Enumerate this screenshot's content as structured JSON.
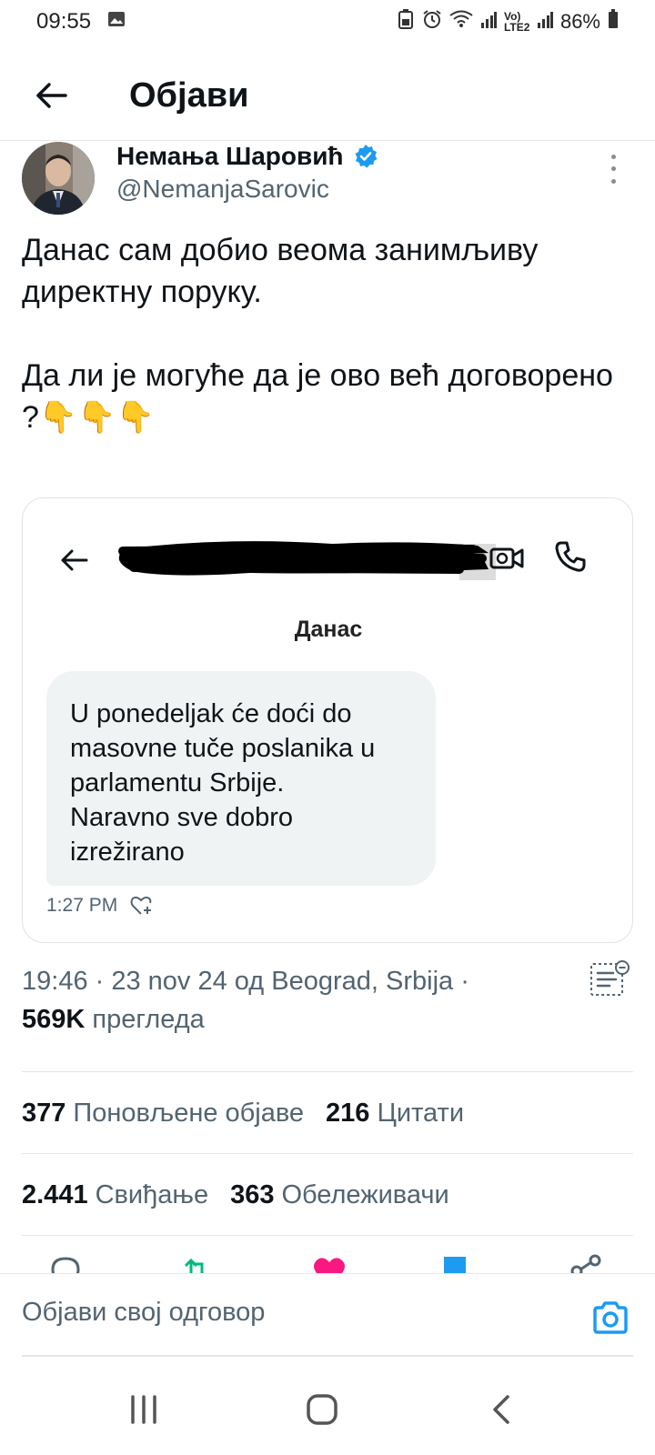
{
  "status_bar": {
    "time": "09:55",
    "battery": "86%",
    "network_label": "Vo) LTE2"
  },
  "header": {
    "title": "Објави"
  },
  "author": {
    "name": "Немања Шаровић",
    "handle": "@NemanjaSarovic",
    "verified": true
  },
  "tweet": {
    "text": "Данас сам добио веома занимљиву директну поруку.\n\nДа ли је могуће да је ово већ договорено ?👇👇👇"
  },
  "media": {
    "dm_date": "Данас",
    "message": "U ponedeljak će doći do masovne tuče poslanika u parlamentu Srbije.\nNaravno sve dobro izrežirano",
    "time": "1:27 PM"
  },
  "meta": {
    "timestamp": "19:46 · 23 nov 24 од Beograd, Srbija ·",
    "views_count": "569K",
    "views_label": "прегледа"
  },
  "stats": {
    "reposts_count": "377",
    "reposts_label": "Поновљене објаве",
    "quotes_count": "216",
    "quotes_label": "Цитати",
    "likes_count": "2.441",
    "likes_label": "Свиђање",
    "bookmarks_count": "363",
    "bookmarks_label": "Обележивачи"
  },
  "reply": {
    "placeholder": "Објави свој одговор"
  },
  "colors": {
    "accent": "#1d9bf0",
    "text": "#0f1419",
    "secondary": "#536471",
    "like": "#f91880",
    "repost": "#00ba7c"
  },
  "icons": [
    "back-arrow-icon",
    "verified-badge-icon",
    "more-vertical-icon",
    "video-call-icon",
    "phone-icon",
    "heart-plus-icon",
    "post-summary-icon",
    "reply-icon",
    "repost-icon",
    "like-icon",
    "bookmark-icon",
    "share-icon",
    "camera-icon"
  ]
}
